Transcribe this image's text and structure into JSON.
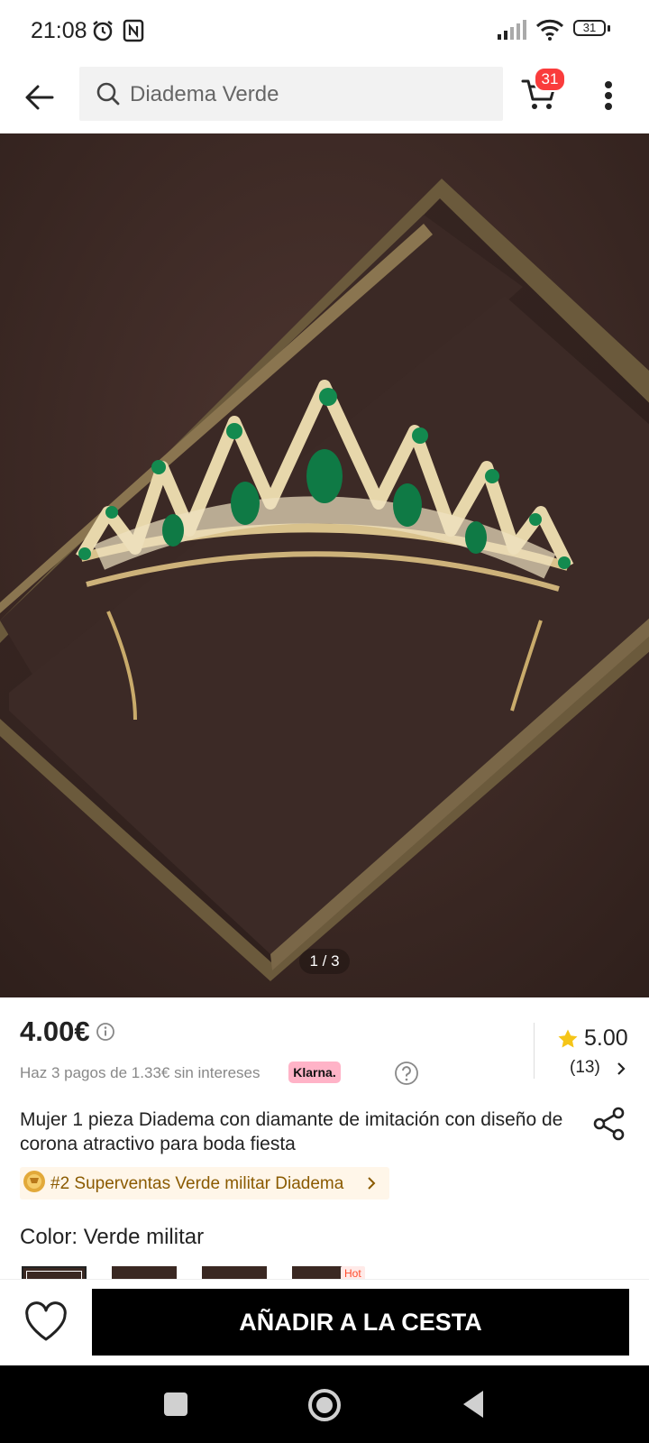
{
  "status": {
    "time": "21:08",
    "battery": "31"
  },
  "header": {
    "search_placeholder": "Diadema Verde",
    "cart_count": "31"
  },
  "gallery": {
    "pager": "1 / 3"
  },
  "product": {
    "price": "4.00€",
    "installments": "Haz 3 pagos de 1.33€ sin intereses",
    "klarna_label": "Klarna.",
    "rating": "5.00",
    "reviews": "(13)",
    "title": "Mujer 1 pieza Diadema con diamante de imitación con diseño de corona atractivo para boda fiesta",
    "bestseller": "#2 Superventas Verde militar Diadema",
    "color_label": "Color:",
    "color_value": "Verde militar",
    "hot_badge": "Hot"
  },
  "actions": {
    "add_to_cart": "AÑADIR A LA CESTA"
  },
  "colors": {
    "accent_red": "#fa3c3c",
    "star": "#f5c518",
    "klarna_pink": "#ffb3c7",
    "bestseller_text": "#8a5a00"
  },
  "icons": [
    "alarm-icon",
    "nfc-icon",
    "signal-icon",
    "wifi-icon",
    "battery-icon",
    "back-arrow-icon",
    "search-icon",
    "cart-icon",
    "more-vert-icon",
    "info-icon",
    "help-icon",
    "star-icon",
    "chevron-right-icon",
    "share-icon",
    "medal-icon",
    "heart-icon",
    "nav-square-icon",
    "nav-home-icon",
    "nav-back-icon"
  ]
}
